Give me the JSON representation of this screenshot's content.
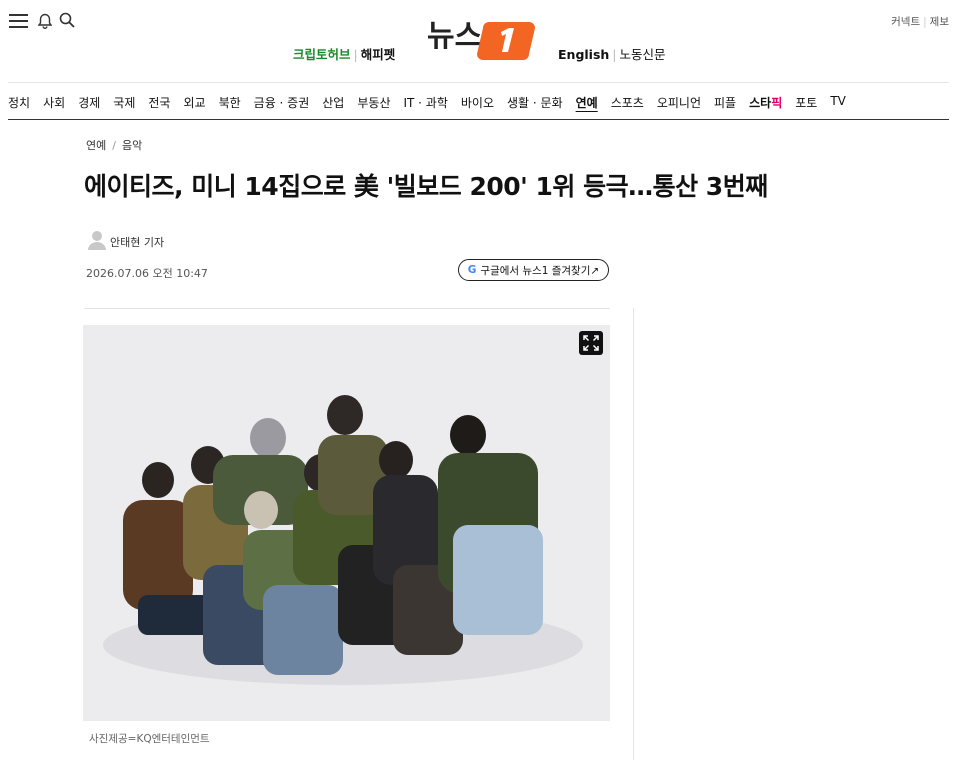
{
  "header": {
    "logo_text": "뉴스1",
    "promo_left": [
      "크립토허브",
      "해피펫"
    ],
    "promo_right": [
      "English",
      "노동신문"
    ],
    "utility": [
      "커넥트",
      "제보"
    ]
  },
  "gnb": {
    "items": [
      "정치",
      "사회",
      "경제",
      "국제",
      "전국",
      "외교",
      "북한",
      "금융 · 증권",
      "산업",
      "부동산",
      "IT · 과학",
      "바이오",
      "생활 · 문화",
      "연예",
      "스포츠",
      "오피니언",
      "피플",
      "스타픽",
      "포토",
      "TV"
    ],
    "active": "연예"
  },
  "article": {
    "breadcrumb": [
      "연예",
      "음악"
    ],
    "headline": "에이티즈, 미니 14집으로 美 '빌보드 200' 1위 등극…통산 3번째",
    "reporter": "안태현 기자",
    "date": "2026.07.06 오전 10:47",
    "google_button": "구글에서 뉴스1 즐겨찾기↗",
    "photo_caption": "사진제공=KQ엔터테인먼트"
  },
  "colors": {
    "accent": "#f26522",
    "promo_green": "#1a8a2e",
    "star_pink": "#e0006f"
  }
}
